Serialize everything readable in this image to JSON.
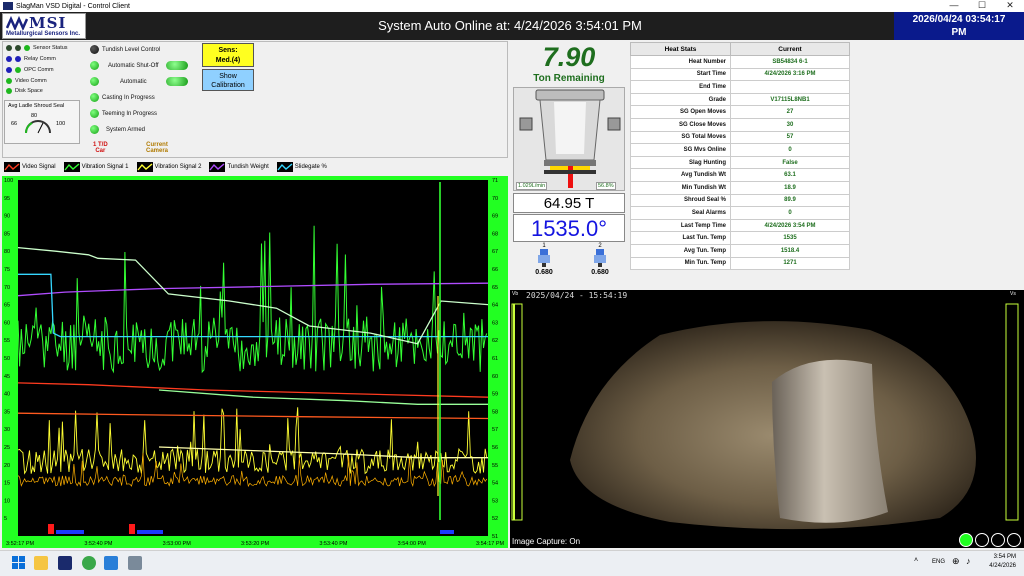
{
  "window": {
    "title": "SlagMan VSD Digital - Control Client",
    "min_glyph": "—",
    "max_glyph": "☐",
    "close_glyph": "✕"
  },
  "header": {
    "logo_mark": "MSI",
    "logo_name": "Metallurgical Sensors Inc.",
    "title": "System Auto Online at: 4/24/2026 3:54:01 PM",
    "clock_date": "2026/04/24 03:54:17",
    "clock_ampm": "PM"
  },
  "status": {
    "sensor_status": "Sensor Status",
    "relay_comm": "Relay Comm",
    "opc_comm": "OPC Comm",
    "video_comm": "Video Comm",
    "disk_space": "Disk Space",
    "gauge_title": "Avg Ladle Shroud Seal",
    "gauge_min": "66",
    "gauge_mid": "80",
    "gauge_max": "100",
    "tundish_level_control": "Tundish Level Control",
    "automatic_shutoff": "Automatic Shut-Off",
    "automatic": "Automatic",
    "casting_in_progress": "Casting In Progress",
    "teeming_in_progress": "Teeming In Progress",
    "system_armed": "System Armed",
    "sens_label": "Sens:",
    "sens_value": "Med.(4)",
    "show_calibration_1": "Show",
    "show_calibration_2": "Calibration",
    "td_car_1": "1 T/D",
    "td_car_2": "Car",
    "current_camera_1": "Current",
    "current_camera_2": "Camera"
  },
  "legend": {
    "items": [
      {
        "label": "Video Signal",
        "color": "#ff3b1f"
      },
      {
        "label": "Vibration Signal 1",
        "color": "#33ff33"
      },
      {
        "label": "Vibration Signal 2",
        "color": "#ffff33"
      },
      {
        "label": "Tundish Weight",
        "color": "#b04cff"
      },
      {
        "label": "Slidegate %",
        "color": "#35d7ff"
      }
    ]
  },
  "chart_data": {
    "type": "line",
    "x_ticks": [
      "3:52:17 PM",
      "3:52:40 PM",
      "3:53:00 PM",
      "3:53:20 PM",
      "3:53:40 PM",
      "3:54:00 PM",
      "3:54:17 PM"
    ],
    "y_left_ticks": [
      "100",
      "95",
      "90",
      "85",
      "80",
      "75",
      "70",
      "65",
      "60",
      "55",
      "50",
      "45",
      "40",
      "35",
      "30",
      "25",
      "20",
      "15",
      "10",
      "5"
    ],
    "y_right_ticks": [
      "71",
      "70",
      "69",
      "68",
      "67",
      "66",
      "65",
      "64",
      "63",
      "62",
      "61",
      "60",
      "59",
      "58",
      "57",
      "56",
      "55",
      "54",
      "53",
      "52",
      "51"
    ],
    "ylim_left": [
      0,
      100
    ],
    "ylim_right": [
      50,
      71
    ],
    "series": [
      {
        "name": "Video Signal",
        "color": "#ff3b1f",
        "points": [
          [
            0,
            43
          ],
          [
            15,
            42.5
          ],
          [
            40,
            41
          ],
          [
            70,
            40
          ],
          [
            100,
            39
          ]
        ]
      },
      {
        "name": "Video Signal (lower)",
        "color": "#ff5a1f",
        "points": [
          [
            0,
            34.5
          ],
          [
            30,
            34
          ],
          [
            60,
            33.5
          ],
          [
            100,
            33
          ]
        ]
      },
      {
        "name": "Tundish Weight",
        "color": "#b04cff",
        "points": [
          [
            0,
            67.5
          ],
          [
            10,
            68.5
          ],
          [
            30,
            69.5
          ],
          [
            50,
            70
          ],
          [
            75,
            70.7
          ],
          [
            100,
            71
          ]
        ]
      },
      {
        "name": "Slidegate %",
        "color": "#35d7ff",
        "points": [
          [
            0,
            73.5
          ],
          [
            7,
            73.5
          ],
          [
            7.5,
            57
          ],
          [
            9,
            56
          ],
          [
            100,
            56
          ]
        ]
      },
      {
        "name": "Vibration Signal 1 (upper)",
        "color": "#ccffcc",
        "points": [
          [
            0,
            81
          ],
          [
            8,
            80
          ],
          [
            15,
            79
          ],
          [
            17,
            78
          ],
          [
            25,
            77.5
          ],
          [
            32,
            68
          ],
          [
            45,
            66
          ],
          [
            55,
            64
          ],
          [
            62,
            59
          ],
          [
            75,
            57
          ],
          [
            85,
            54
          ],
          [
            90,
            66
          ],
          [
            100,
            65
          ]
        ]
      },
      {
        "name": "Vibration Signal 1 (lower band)",
        "color": "#99ff99",
        "points": [
          [
            30,
            41
          ],
          [
            50,
            39
          ],
          [
            70,
            38
          ],
          [
            85,
            37
          ],
          [
            100,
            37
          ]
        ]
      },
      {
        "name": "Vibration Signal 2 (upper)",
        "color": "#ffffaa",
        "points": [
          [
            30,
            25
          ],
          [
            50,
            24
          ],
          [
            70,
            23
          ],
          [
            85,
            22
          ],
          [
            100,
            22
          ]
        ]
      }
    ]
  },
  "stats": {
    "tons_value": "7.90",
    "tons_label": "Ton Remaining",
    "flow_rate": "1.029L/min",
    "slide_pct": "56.8%",
    "weight": "64.95 T",
    "temperature": "1535.0°",
    "nozzle_1_label": "1",
    "nozzle_1_value": "0.680",
    "nozzle_2_label": "2",
    "nozzle_2_value": "0.680",
    "table_header_1": "Heat Stats",
    "table_header_2": "Current",
    "rows": [
      {
        "k": "Heat Number",
        "v": "SB54834 6-1"
      },
      {
        "k": "Start Time",
        "v": "4/24/2026 3:16 PM"
      },
      {
        "k": "End Time",
        "v": ""
      },
      {
        "k": "Grade",
        "v": "V17115L8NB1"
      },
      {
        "k": "SG Open Moves",
        "v": "27"
      },
      {
        "k": "SG Close Moves",
        "v": "30"
      },
      {
        "k": "SG Total Moves",
        "v": "57"
      },
      {
        "k": "SG Mvs Online",
        "v": "0"
      },
      {
        "k": "Slag Hunting",
        "v": "False"
      },
      {
        "k": "Avg Tundish Wt",
        "v": "63.1"
      },
      {
        "k": "Min Tundish Wt",
        "v": "18.9"
      },
      {
        "k": "Shroud Seal %",
        "v": "89.9"
      },
      {
        "k": "Seal Alarms",
        "v": "0"
      },
      {
        "k": "Last Temp Time",
        "v": "4/24/2026 3:54 PM"
      },
      {
        "k": "Last Tun. Temp",
        "v": "1535"
      },
      {
        "k": "Avg Tun. Temp",
        "v": "1518.4"
      },
      {
        "k": "Min Tun. Temp",
        "v": "1271"
      }
    ]
  },
  "camera": {
    "timestamp": "2025/04/24 - 15:54:19",
    "capture": "Image Capture: On",
    "left_bar_label": "Vb",
    "right_bar_label": "Vs"
  },
  "taskbar": {
    "lang": "ENG",
    "time": "3:54 PM",
    "date": "4/24/2026"
  }
}
